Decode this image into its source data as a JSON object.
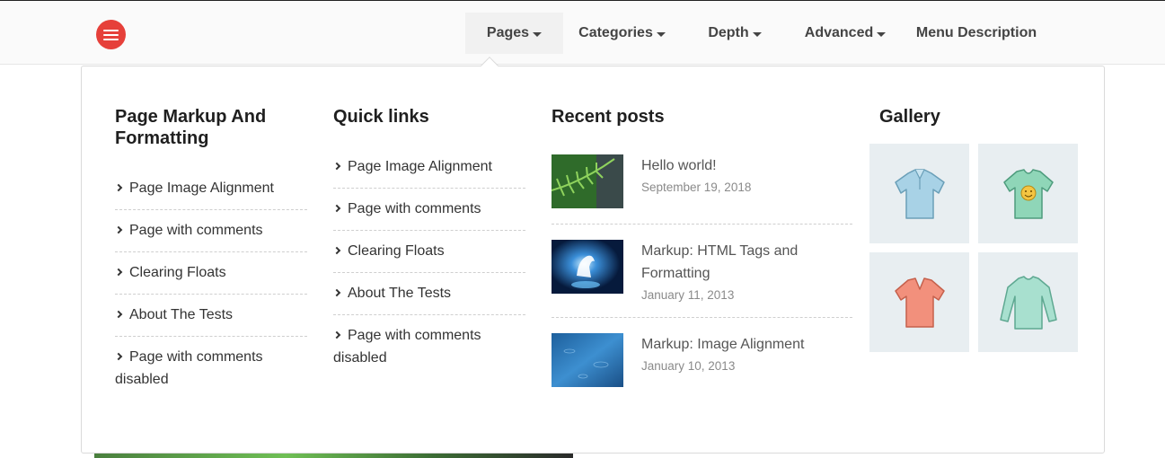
{
  "nav": {
    "items": [
      {
        "label": "Pages",
        "dropdown": true,
        "active": true
      },
      {
        "label": "Categories",
        "dropdown": true,
        "active": false
      },
      {
        "label": "Depth",
        "dropdown": true,
        "active": false
      },
      {
        "label": "Advanced",
        "dropdown": true,
        "active": false
      },
      {
        "label": "Menu Description",
        "dropdown": false,
        "active": false
      }
    ]
  },
  "megamenu": {
    "col1": {
      "title": "Page Markup And Formatting",
      "links": [
        "Page Image Alignment",
        "Page with comments",
        "Clearing Floats",
        "About The Tests",
        "Page with comments disabled"
      ]
    },
    "col2": {
      "title": "Quick links",
      "links": [
        "Page Image Alignment",
        "Page with comments",
        "Clearing Floats",
        "About The Tests",
        "Page with comments disabled"
      ]
    },
    "recent": {
      "title": "Recent posts",
      "posts": [
        {
          "title": "Hello world!",
          "date": "September 19, 2018"
        },
        {
          "title": "Markup: HTML Tags and Formatting",
          "date": "January 11, 2013"
        },
        {
          "title": "Markup: Image Alignment",
          "date": "January 10, 2013"
        }
      ]
    },
    "gallery": {
      "title": "Gallery",
      "items": [
        "blue-polo-shirt",
        "green-smiley-tshirt",
        "coral-vneck-tshirt",
        "mint-longsleeve-shirt"
      ]
    }
  },
  "colors": {
    "accent": "#e6403a",
    "topbar": "#fafafa",
    "divider": "#cfcfcf"
  }
}
